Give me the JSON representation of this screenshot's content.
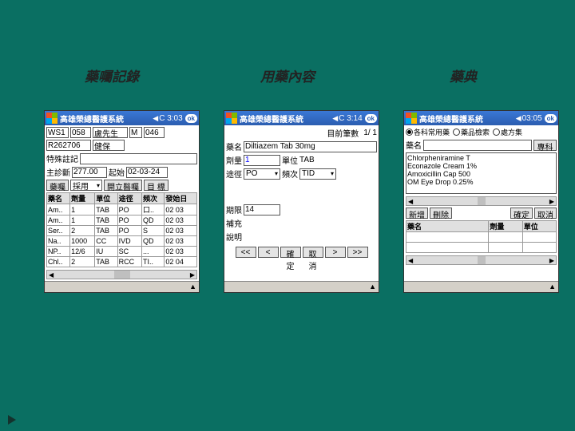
{
  "titles": {
    "left": "藥囑記錄",
    "mid": "用藥內容",
    "right": "藥典"
  },
  "left": {
    "app": "高雄榮總醫護系統",
    "time": "C 3:03",
    "ok": "ok",
    "ws": "WS1",
    "wsNo": "058",
    "patient": "盧先生",
    "sex": "M",
    "age": "046",
    "chart": "R262706",
    "ins": "健保",
    "specialLabel": "特殊註記",
    "dxLabel": "主診斷",
    "dxVal": "277.00",
    "startLabel": "起始",
    "startDate": "02-03-24",
    "tab1": "藥囑",
    "tab1val": "採用",
    "tab2": "開立醫囑",
    "tab3": "目  標",
    "cols": [
      "藥名",
      "劑量",
      "單位",
      "途徑",
      "頻次",
      "發始日"
    ],
    "rows": [
      [
        "Am..",
        "1",
        "TAB",
        "PO",
        "口..",
        "02 03"
      ],
      [
        "Am..",
        "1",
        "TAB",
        "PO",
        "QD",
        "02 03"
      ],
      [
        "Ser..",
        "2",
        "TAB",
        "PO",
        "S",
        "02 03"
      ],
      [
        "Na..",
        "1000",
        "CC",
        "IVD",
        "QD",
        "02 03"
      ],
      [
        "NP..",
        "12/6",
        "IU",
        "SC",
        "...",
        "02 03"
      ],
      [
        "Chl..",
        "2",
        "TAB",
        "RCC",
        "TI..",
        "02 04"
      ]
    ]
  },
  "mid": {
    "app": "高雄榮總醫護系統",
    "time": "C 3:14",
    "ok": "ok",
    "pageLabel": "目前筆數",
    "page": "1/ 1",
    "drugLabel": "藥名",
    "drug": "Diltiazem Tab 30mg",
    "doseLabel": "劑量",
    "dose": "1",
    "unitLabel": "單位",
    "unit": "TAB",
    "routeLabel": "途徑",
    "route": "PO",
    "freqLabel": "頻次",
    "freq": "TID",
    "durLabel": "期限",
    "dur": "14",
    "suppLabel": "補充",
    "noteLabel": "說明",
    "nav": [
      "<<",
      "<",
      "確定",
      "取消",
      ">",
      ">>"
    ]
  },
  "right": {
    "app": "高雄榮總醫護系統",
    "time": "03:05",
    "ok": "ok",
    "radios": [
      "各科常用藥",
      "藥品檢索",
      "處方集"
    ],
    "drugLabel": "藥名",
    "deptBtn": "專科用藥",
    "list": [
      "Chlorpheniramine T",
      "Econazole Cream 1%",
      "Amoxicillin Cap 500",
      "OM Eye Drop 0.25%"
    ],
    "btns": [
      "新增",
      "刪除",
      "確定",
      "取消"
    ],
    "cols": [
      "藥名",
      "劑量",
      "單位"
    ]
  }
}
